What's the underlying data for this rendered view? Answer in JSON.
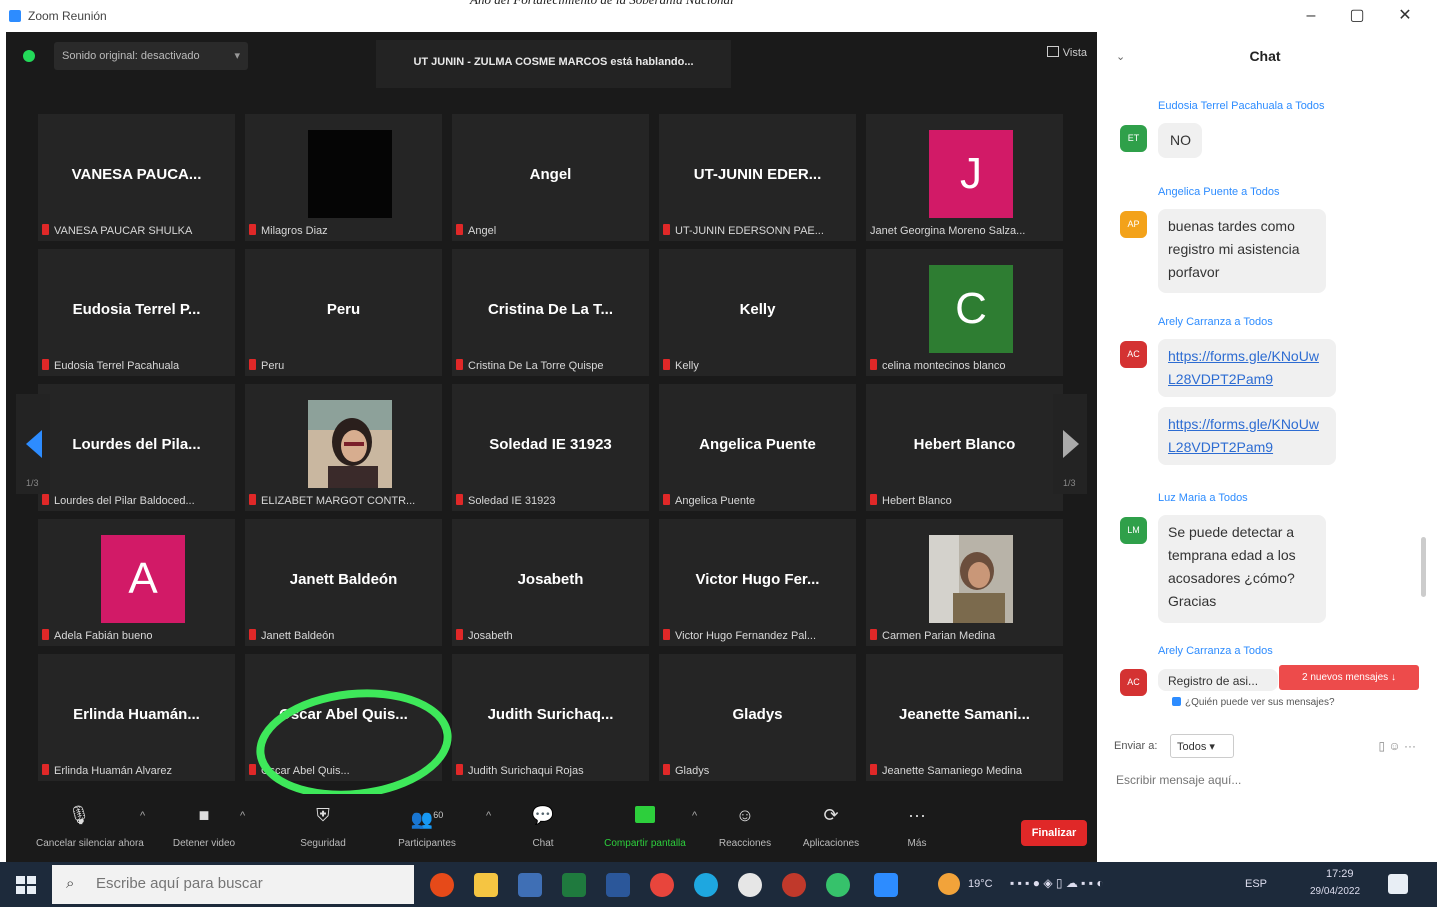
{
  "window": {
    "title": "Zoom Reunión",
    "banner": "Año del Fortalecimiento de la Soberanía Nacional"
  },
  "meeting_bar": {
    "audio_button": "Sonido original: desactivado",
    "speaking": "UT JUNIN - ZULMA COSME MARCOS está hablando...",
    "view_label": "Vista"
  },
  "tiles": [
    {
      "name": "VANESA PAUCA...",
      "label": "VANESA PAUCAR SHULKA"
    },
    {
      "name": "",
      "label": "Milagros Diaz",
      "video": "dark"
    },
    {
      "name": "Angel",
      "label": "Angel"
    },
    {
      "name": "UT-JUNIN EDER...",
      "label": "UT-JUNIN EDERSONN PAE..."
    },
    {
      "name": "",
      "label": "Janet Georgina Moreno Salza...",
      "avatar": "J",
      "avatar_color": "#d21a67",
      "mic": false
    },
    {
      "name": "Eudosia Terrel P...",
      "label": "Eudosia Terrel Pacahuala"
    },
    {
      "name": "Peru",
      "label": "Peru"
    },
    {
      "name": "Cristina De La T...",
      "label": "Cristina De La Torre Quispe"
    },
    {
      "name": "Kelly",
      "label": "Kelly"
    },
    {
      "name": "",
      "label": "celina montecinos blanco",
      "avatar": "C",
      "avatar_color": "#2e7d32"
    },
    {
      "name": "Lourdes del Pila...",
      "label": "Lourdes del Pilar Baldoced..."
    },
    {
      "name": "",
      "label": "ELIZABET MARGOT CONTR...",
      "video": "photo1"
    },
    {
      "name": "Soledad IE 31923",
      "label": "Soledad IE 31923"
    },
    {
      "name": "Angelica Puente",
      "label": "Angelica Puente"
    },
    {
      "name": "Hebert Blanco",
      "label": "Hebert Blanco"
    },
    {
      "name": "",
      "label": "Adela Fabián bueno",
      "avatar": "A",
      "avatar_color": "#d21a67"
    },
    {
      "name": "Janett Baldeón",
      "label": "Janett Baldeón"
    },
    {
      "name": "Josabeth",
      "label": "Josabeth"
    },
    {
      "name": "Victor Hugo Fer...",
      "label": "Victor Hugo Fernandez Pal..."
    },
    {
      "name": "",
      "label": "Carmen Parian Medina",
      "video": "photo2"
    },
    {
      "name": "Erlinda Huamán...",
      "label": "Erlinda Huamán Alvarez"
    },
    {
      "name": "Oscar Abel Quis...",
      "label": "Oscar Abel Quis..."
    },
    {
      "name": "Judith Surichaq...",
      "label": "Judith Surichaqui Rojas"
    },
    {
      "name": "Gladys",
      "label": "Gladys"
    },
    {
      "name": "Jeanette Samani...",
      "label": "Jeanette Samaniego Medina"
    }
  ],
  "pager": {
    "left": "1/3",
    "right": "1/3"
  },
  "toolbar": {
    "items": [
      {
        "label": "Cancelar silenciar ahora",
        "icon": "microphone-icon"
      },
      {
        "label": "Detener video",
        "icon": "video-camera-icon"
      },
      {
        "label": "Seguridad",
        "icon": "shield-icon"
      },
      {
        "label": "Participantes",
        "icon": "participants-icon",
        "count": "60"
      },
      {
        "label": "Chat",
        "icon": "chat-bubble-icon"
      },
      {
        "label": "Compartir pantalla",
        "icon": "share-screen-icon"
      },
      {
        "label": "Reacciones",
        "icon": "reaction-icon"
      },
      {
        "label": "Aplicaciones",
        "icon": "apps-icon"
      },
      {
        "label": "Más",
        "icon": "more-icon"
      }
    ],
    "end_button": "Finalizar"
  },
  "chat": {
    "title": "Chat",
    "messages": [
      {
        "from": "Eudosia Terrel Pacahuala a Todos",
        "initials": "ET",
        "color": "#2fa04a",
        "text": "NO"
      },
      {
        "from": "Angelica Puente a Todos",
        "initials": "AP",
        "color": "#f3a21a",
        "text": "buenas tardes como registro mi asistencia porfavor"
      },
      {
        "from": "Arely Carranza a Todos",
        "initials": "AC",
        "color": "#d43232",
        "text": "https://forms.gle/KNoUwL28VDPT2Pam9"
      },
      {
        "from": "",
        "initials": "",
        "color": "",
        "text": "https://forms.gle/KNoUwL28VDPT2Pam9"
      },
      {
        "from": "Luz Maria a Todos",
        "initials": "LM",
        "color": "#2fa04a",
        "text": "Se puede detectar a temprana edad a los acosadores ¿cómo? Gracias"
      },
      {
        "from": "Arely Carranza a Todos",
        "initials": "AC",
        "color": "#d43232",
        "text": "Registro de asi..."
      }
    ],
    "new_messages": "2 nuevos mensajes ↓",
    "who_can_see": "¿Quién puede ver sus mensajes?",
    "send_to_label": "Enviar a:",
    "send_to_value": "Todos ▾",
    "input_placeholder": "Escribir mensaje aquí..."
  },
  "taskbar": {
    "search_placeholder": "Escribe aquí para buscar",
    "temperature": "19°C",
    "language": "ESP",
    "time": "17:29",
    "date": "29/04/2022"
  }
}
